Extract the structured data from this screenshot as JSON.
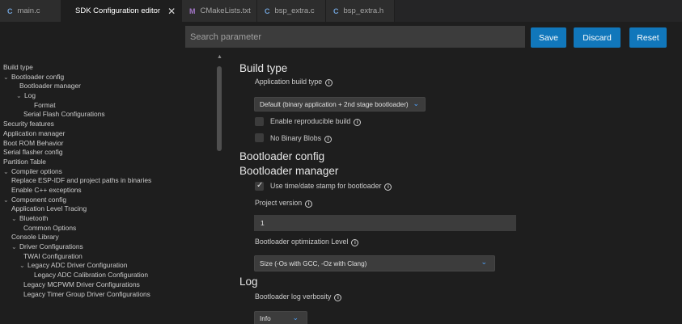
{
  "tabs": [
    {
      "label": "main.c",
      "icon": "c-file-icon"
    },
    {
      "label": "SDK Configuration editor",
      "icon": "espressif-dot-icon",
      "active": true,
      "close": "✕"
    },
    {
      "label": "CMakeLists.txt",
      "icon": "cmake-file-icon"
    },
    {
      "label": "bsp_extra.c",
      "icon": "c-file-icon"
    },
    {
      "label": "bsp_extra.h",
      "icon": "c-file-icon"
    }
  ],
  "icons": {
    "c": "C",
    "m": "M",
    "chev_down": "⌄",
    "info": "i",
    "caret": "⌄",
    "scroll_up": "▲"
  },
  "toolbar": {
    "search_placeholder": "Search parameter",
    "save_label": "Save",
    "discard_label": "Discard",
    "reset_label": "Reset"
  },
  "tree": [
    {
      "label": "Build type",
      "level": 0
    },
    {
      "label": "Bootloader config",
      "level": 1,
      "expanded": true
    },
    {
      "label": "Bootloader manager",
      "level": 2
    },
    {
      "label": "Log",
      "level": 2,
      "expanded": true
    },
    {
      "label": "Format",
      "level": 4
    },
    {
      "label": "Serial Flash Configurations",
      "level": 2
    },
    {
      "label": "Security features",
      "level": 0
    },
    {
      "label": "Application manager",
      "level": 0
    },
    {
      "label": "Boot ROM Behavior",
      "level": 0
    },
    {
      "label": "Serial flasher config",
      "level": 0
    },
    {
      "label": "Partition Table",
      "level": 0
    },
    {
      "label": "Compiler options",
      "level": 1,
      "expanded": true
    },
    {
      "label": "Replace ESP-IDF and project paths in binaries",
      "level": 2
    },
    {
      "label": "Enable C++ exceptions",
      "level": 2
    },
    {
      "label": "Component config",
      "level": 1,
      "expanded": true
    },
    {
      "label": "Application Level Tracing",
      "level": 2
    },
    {
      "label": "Bluetooth",
      "level": 2,
      "expanded": true
    },
    {
      "label": "Common Options",
      "level": 4
    },
    {
      "label": "Console Library",
      "level": 2
    },
    {
      "label": "Driver Configurations",
      "level": 2,
      "expanded": true
    },
    {
      "label": "TWAI Configuration",
      "level": 4
    },
    {
      "label": "Legacy ADC Driver Configuration",
      "level": 3,
      "expanded": true
    },
    {
      "label": "Legacy ADC Calibration Configuration",
      "level": 5
    },
    {
      "label": "Legacy MCPWM Driver Configurations",
      "level": 4
    },
    {
      "label": "Legacy Timer Group Driver Configurations",
      "level": 4
    }
  ],
  "main": {
    "build_type": {
      "heading": "Build type",
      "app_build_type_label": "Application build type",
      "app_build_type_value": "Default (binary application + 2nd stage bootloader)",
      "reproducible_label": "Enable reproducible build",
      "reproducible_checked": false,
      "no_blobs_label": "No Binary Blobs",
      "no_blobs_checked": false
    },
    "bootloader_config": {
      "heading": "Bootloader config"
    },
    "bootloader_manager": {
      "heading": "Bootloader manager",
      "timestamp_label": "Use time/date stamp for bootloader",
      "timestamp_checked": true,
      "project_version_label": "Project version",
      "project_version_value": "1",
      "opt_level_label": "Bootloader optimization Level",
      "opt_level_value": "Size (-Os with GCC, -Oz with Clang)"
    },
    "log": {
      "heading": "Log",
      "verbosity_label": "Bootloader log verbosity",
      "verbosity_value": "Info"
    }
  }
}
